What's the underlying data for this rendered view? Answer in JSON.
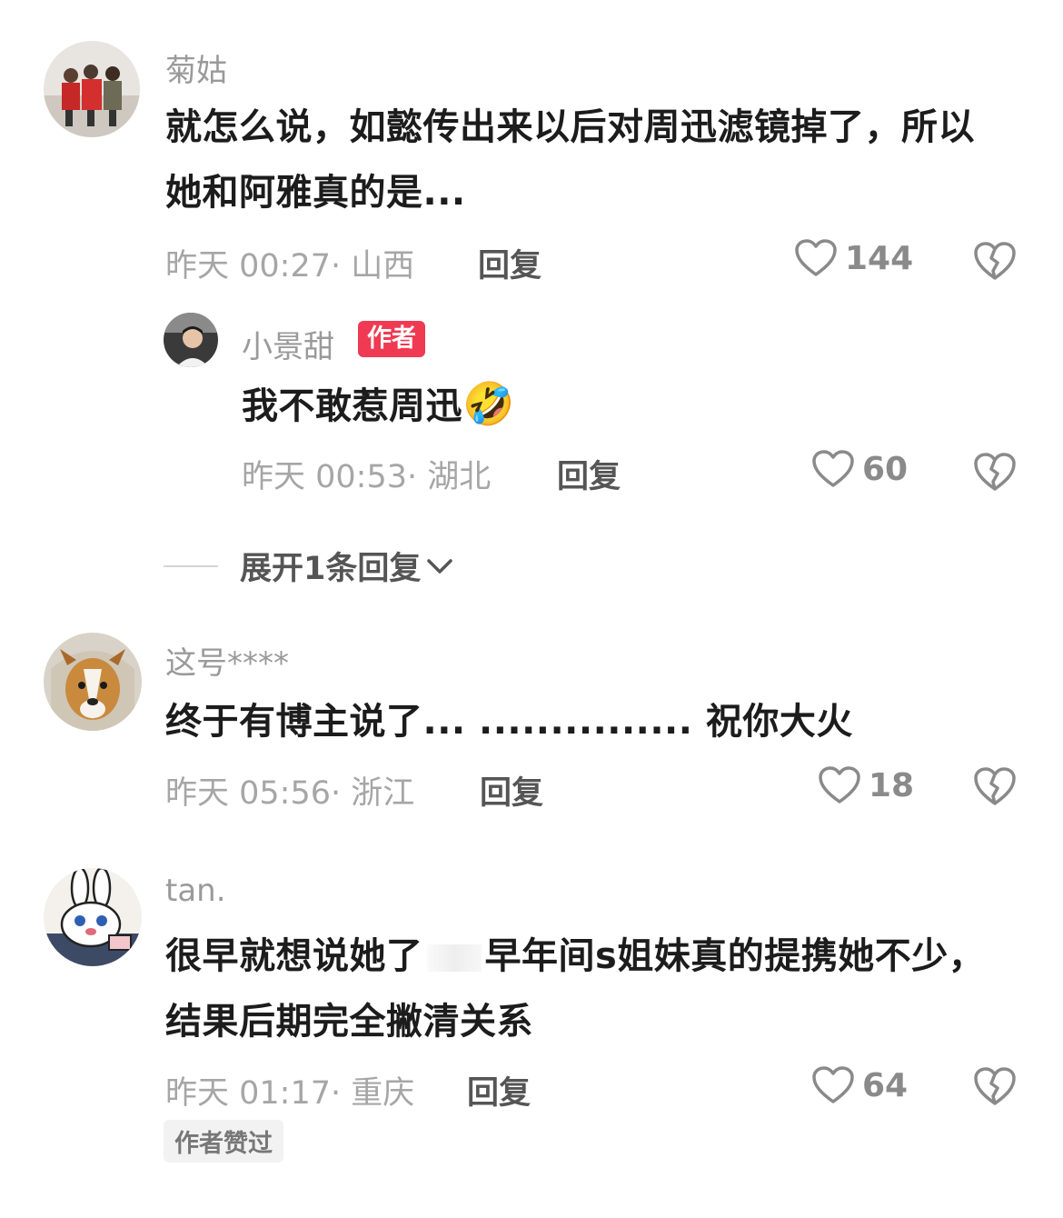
{
  "comments": [
    {
      "username": "菊姑",
      "text": "就怎么说，如懿传出来以后对周迅滤镜掉了，所以她和阿雅真的是...",
      "time": "昨天 00:27",
      "location": "山西",
      "reply_label": "回复",
      "likes": "144",
      "avatar_icon": "group-photo-avatar",
      "reply": {
        "username": "小景甜",
        "badge": "作者",
        "text": "我不敢惹周迅",
        "emoji": "🤣",
        "time": "昨天 00:53",
        "location": "湖北",
        "reply_label": "回复",
        "likes": "60"
      },
      "expand_label": "展开1条回复"
    },
    {
      "username": "这号****",
      "text": "终于有博主说了... ............... 祝你大火",
      "time": "昨天 05:56",
      "location": "浙江",
      "reply_label": "回复",
      "likes": "18",
      "avatar_icon": "dog-avatar"
    },
    {
      "username": "tan.",
      "text_a": "很早就想说她了",
      "text_b": "早年间s姐妹真的提携她不少，结果后期完全撇清关系",
      "time": "昨天 01:17",
      "location": "重庆",
      "reply_label": "回复",
      "likes": "64",
      "liked_tag": "作者赞过",
      "avatar_icon": "rabbit-avatar"
    }
  ],
  "colors": {
    "author_badge": "#f03a53",
    "meta": "#a6a6a6",
    "username": "#9a9a9a"
  }
}
